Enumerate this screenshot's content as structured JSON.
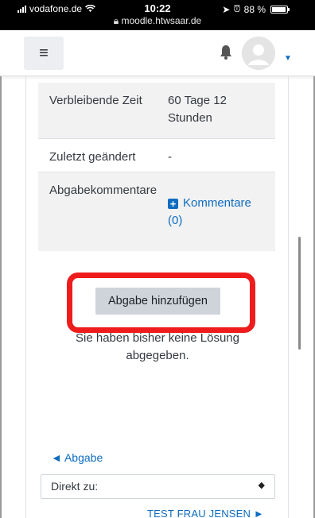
{
  "status_bar": {
    "carrier": "vodafone.de",
    "time": "10:22",
    "url": "moodle.htwsaar.de",
    "battery": "88 %"
  },
  "navbar": {
    "menu_icon": "hamburger-icon",
    "notification_icon": "bell-icon",
    "user_icon": "avatar"
  },
  "status_table": {
    "rows": [
      {
        "label": "Verbleibende Zeit",
        "value": "60 Tage 12 Stunden"
      },
      {
        "label": "Zuletzt geändert",
        "value": "-"
      },
      {
        "label": "Abgabekommentare",
        "value": "Kommentare (0)"
      }
    ]
  },
  "submission": {
    "button_label": "Abgabe hinzufügen",
    "notice": "Sie haben bisher keine Lösung abgegeben.",
    "highlight_color": "#ee1c1c"
  },
  "navigation": {
    "prev_label": "◄ Abgabe",
    "jump_label": "Direkt zu:",
    "next_label": "TEST FRAU JENSEN ►"
  },
  "colors": {
    "link": "#0f6cbf",
    "button_bg": "#ced4da"
  }
}
